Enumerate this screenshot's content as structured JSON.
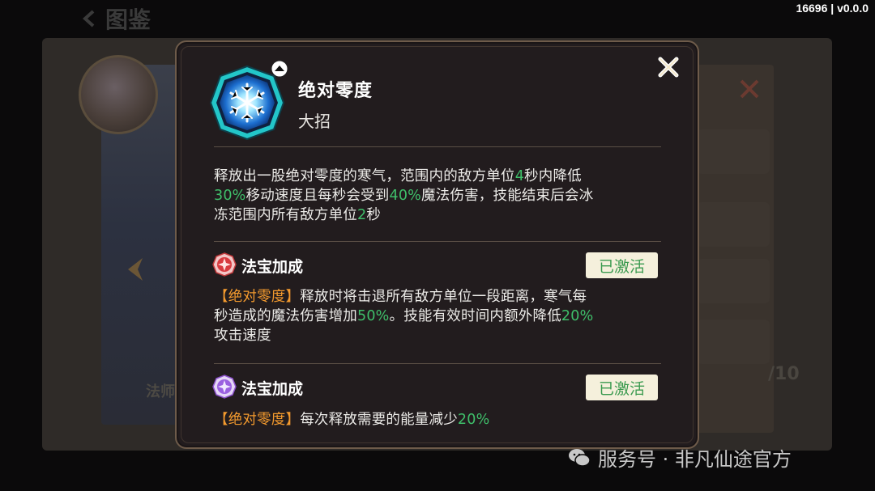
{
  "version": "16696 | v0.0.0",
  "background": {
    "title": "图鉴",
    "side_label": "法师",
    "count": "/10"
  },
  "skill": {
    "name": "绝对零度",
    "type": "大招",
    "description_parts": {
      "p1": "释放出一股绝对零度的寒气，范围内的敌方单位",
      "v1": "4",
      "p2": "秒内降低",
      "v2": "30%",
      "p3": "移动速度且每秒会受到",
      "v3": "40%",
      "p4": "魔法伤害，技能结束后会冰冻范围内所有敌方单位",
      "v4": "2",
      "p5": "秒"
    }
  },
  "bonuses": [
    {
      "title": "法宝加成",
      "status": "已激活",
      "tag": "【绝对零度】",
      "p1": "释放时将击退所有敌方单位一段距离，寒气每秒造成的魔法伤害增加",
      "v1": "50%",
      "p2": "。技能有效时间内额外降低",
      "v2": "20%",
      "p3": "攻击速度",
      "icon": "red-talisman-icon"
    },
    {
      "title": "法宝加成",
      "status": "已激活",
      "tag": "【绝对零度】",
      "p1": "每次释放需要的能量减少",
      "v1": "20%",
      "icon": "purple-talisman-icon"
    }
  ],
  "watermark": "服务号 · 非凡仙途官方",
  "colors": {
    "highlight_green": "#3fbf6a",
    "tag_orange": "#f39a2e",
    "status_text": "#3a9a4f",
    "status_bg": "#f5f0dc",
    "popup_bg": "#221c1e",
    "popup_border": "#6e5b4a"
  }
}
